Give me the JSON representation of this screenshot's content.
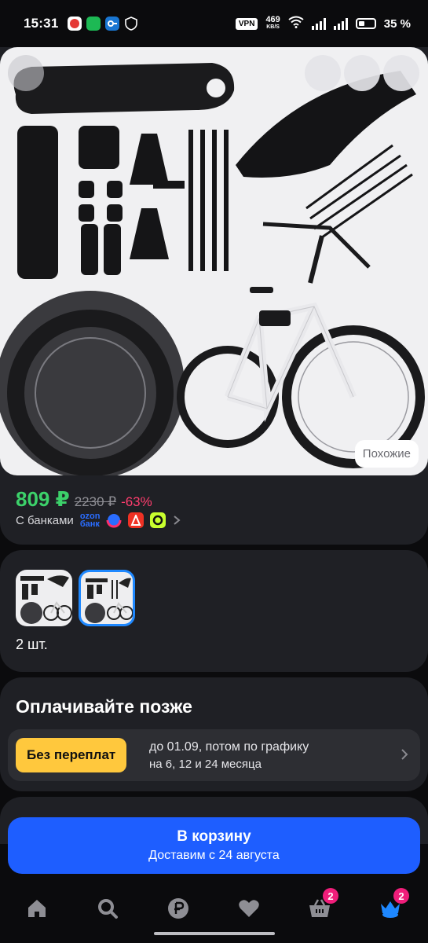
{
  "status_bar": {
    "time": "15:31",
    "vpn": "VPN",
    "net_speed": "469",
    "net_unit": "KB/S",
    "battery": "35 %"
  },
  "product": {
    "similar_label": "Похожие",
    "price": "809 ₽",
    "old_price": "2230 ₽",
    "discount": "-63%",
    "banks_label": "С банками",
    "ozon_bank": [
      "ozon",
      "банк"
    ]
  },
  "variants": {
    "quantity": "2 шт."
  },
  "pay_later": {
    "title": "Оплачивайте позже",
    "badge": "Без переплат",
    "line1": "до 01.09, потом по графику",
    "line2": "на 6, 12 и 24 месяца"
  },
  "cart": {
    "label": "В корзину",
    "delivery": "Доставим с 24 августа"
  },
  "nav": {
    "cart_badge": "2",
    "profile_badge": "2"
  },
  "colors": {
    "price_green": "#3cd16a",
    "discount_pink": "#ff3d6e",
    "accent_blue": "#1e5eff",
    "badge_yellow": "#ffc83d",
    "badge_pink": "#f01e7a"
  }
}
